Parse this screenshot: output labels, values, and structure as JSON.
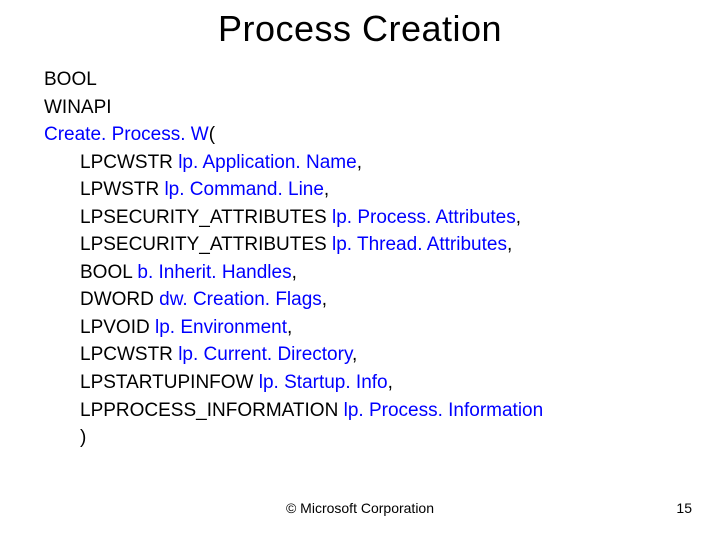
{
  "title": "Process Creation",
  "sig": {
    "ret": "BOOL",
    "callconv": "WINAPI",
    "funcname": "Create. Process. W",
    "open": "(",
    "params": [
      {
        "type": "LPCWSTR ",
        "name": "lp. Application. Name",
        "tail": ","
      },
      {
        "type": "LPWSTR ",
        "name": "lp. Command. Line",
        "tail": ","
      },
      {
        "type": "LPSECURITY_ATTRIBUTES ",
        "name": "lp. Process. Attributes",
        "tail": ","
      },
      {
        "type": "LPSECURITY_ATTRIBUTES ",
        "name": "lp. Thread. Attributes",
        "tail": ","
      },
      {
        "type": "BOOL ",
        "name": "b. Inherit. Handles",
        "tail": ","
      },
      {
        "type": "DWORD ",
        "name": "dw. Creation. Flags",
        "tail": ","
      },
      {
        "type": "LPVOID ",
        "name": "lp. Environment",
        "tail": ","
      },
      {
        "type": "LPCWSTR ",
        "name": "lp. Current. Directory",
        "tail": ","
      },
      {
        "type": "LPSTARTUPINFOW ",
        "name": "lp. Startup. Info",
        "tail": ","
      },
      {
        "type": "LPPROCESS_INFORMATION ",
        "name": "lp. Process. Information",
        "tail": ""
      }
    ],
    "close": ")"
  },
  "footer": "© Microsoft Corporation",
  "page": "15"
}
